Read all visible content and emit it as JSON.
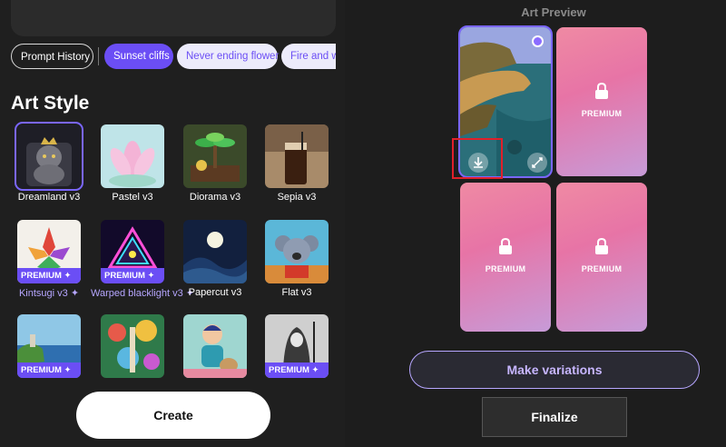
{
  "chips": {
    "history": "Prompt History",
    "active": "Sunset cliffs",
    "suggestions": [
      "Never ending flower",
      "Fire and wa"
    ]
  },
  "art_style": {
    "title": "Art Style",
    "premium_tag": "PREMIUM ✦",
    "tiles": [
      {
        "label": "Dreamland v3",
        "premium": false
      },
      {
        "label": "Pastel v3",
        "premium": false
      },
      {
        "label": "Diorama v3",
        "premium": false
      },
      {
        "label": "Sepia v3",
        "premium": false
      },
      {
        "label": "Kintsugi v3 ✦",
        "premium": true
      },
      {
        "label": "Warped blacklight v3 ✦",
        "premium": true
      },
      {
        "label": "Papercut v3",
        "premium": false
      },
      {
        "label": "Flat v3",
        "premium": false
      },
      {
        "label": "",
        "premium": true
      },
      {
        "label": "",
        "premium": false
      },
      {
        "label": "",
        "premium": false
      },
      {
        "label": "",
        "premium": true
      }
    ]
  },
  "create_label": "Create",
  "preview": {
    "title": "Art Preview",
    "premium_text": "PREMIUM",
    "make_variations": "Make variations",
    "finalize": "Finalize"
  },
  "colors": {
    "accent": "#6b4ef5",
    "highlight": "#e0202a"
  }
}
